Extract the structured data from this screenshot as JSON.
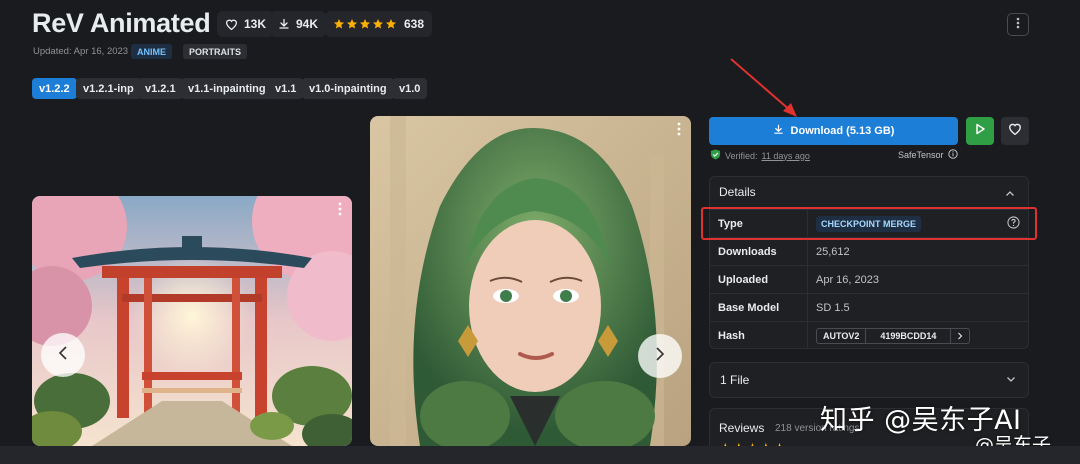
{
  "model": {
    "title": "ReV Animated",
    "likes": "13K",
    "downloads": "94K",
    "rating_count": "638",
    "rating_stars": 5,
    "updated": "Updated: Apr 16, 2023",
    "tags": [
      "ANIME",
      "PORTRAITS"
    ]
  },
  "versions": [
    "v1.2.2",
    "v1.2.1-inp",
    "v1.2.1",
    "v1.1-inpainting",
    "v1.1",
    "v1.0-inpainting",
    "v1.0"
  ],
  "selected_version": "v1.2.2",
  "actions": {
    "download_label": "Download (5.13 GB)",
    "verified_label": "Verified:",
    "verified_time": "11 days ago",
    "safetensor_label": "SafeTensor"
  },
  "details": {
    "title": "Details",
    "rows": [
      {
        "key": "Type",
        "value": "CHECKPOINT MERGE"
      },
      {
        "key": "Downloads",
        "value": "25,612"
      },
      {
        "key": "Uploaded",
        "value": "Apr 16, 2023"
      },
      {
        "key": "Base Model",
        "value": "SD 1.5"
      },
      {
        "key": "Hash",
        "value": ""
      }
    ],
    "hash_type": "AUTOV2",
    "hash_value": "4199BCDD14"
  },
  "files": {
    "label": "1 File"
  },
  "reviews": {
    "title": "Reviews",
    "subtitle": "218 version ratings"
  },
  "watermark": {
    "main": "知乎 @吴东子AI",
    "secondary": "@吴东子"
  },
  "colors": {
    "background": "#1a1b1e",
    "accent": "#1c7ed6",
    "play": "#2f9e44",
    "star": "#fab005",
    "highlight": "#e03131"
  },
  "icons": [
    "heart-icon",
    "download-icon",
    "star-icon",
    "kebab-menu-icon",
    "play-icon",
    "shield-check-icon",
    "info-icon",
    "chevron-up-icon",
    "chevron-down-icon",
    "chevron-left-icon",
    "chevron-right-icon",
    "help-icon",
    "copy-icon"
  ]
}
